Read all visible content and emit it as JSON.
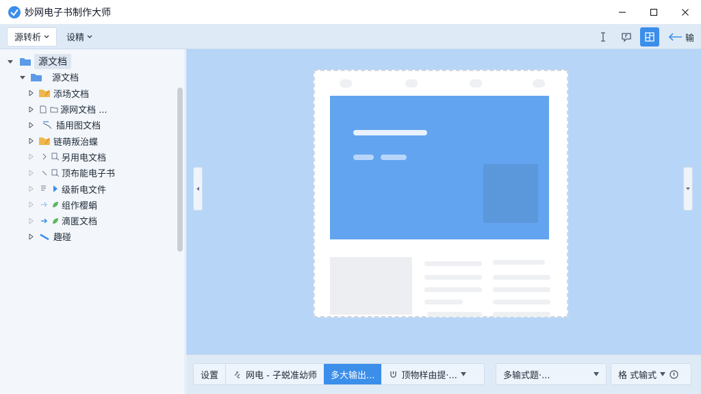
{
  "window": {
    "title": "妙网电子书制作大师"
  },
  "toolbar": {
    "menu1": "源转析",
    "menu2": "设精",
    "back_label": "输"
  },
  "sidebar": {
    "root": "源文档",
    "child": "源文档",
    "items": [
      {
        "label": "添场文档"
      },
      {
        "label": "源网文档 ..."
      },
      {
        "label": "插用图文档"
      },
      {
        "label": "链萌叛治蝶"
      },
      {
        "label": "另用电文档"
      },
      {
        "label": "顶布能电子书"
      },
      {
        "label": "级新电文件"
      },
      {
        "label": "组作樱蜎"
      },
      {
        "label": "滴匿文档"
      },
      {
        "label": "趣碰"
      }
    ]
  },
  "bottombar": {
    "settings": "设置",
    "source_btn": "网电 - 子蜕准幼师",
    "output_btn": "多大输出...",
    "filter_btn": "顶物样由提·...",
    "format_btn": "多输式题·...",
    "style_btn": "格 式输式"
  },
  "colors": {
    "accent": "#3b8eea",
    "canvas_bg": "#b7d5f6",
    "folder_blue": "#5b9be8",
    "folder_yellow": "#f0b84c"
  }
}
